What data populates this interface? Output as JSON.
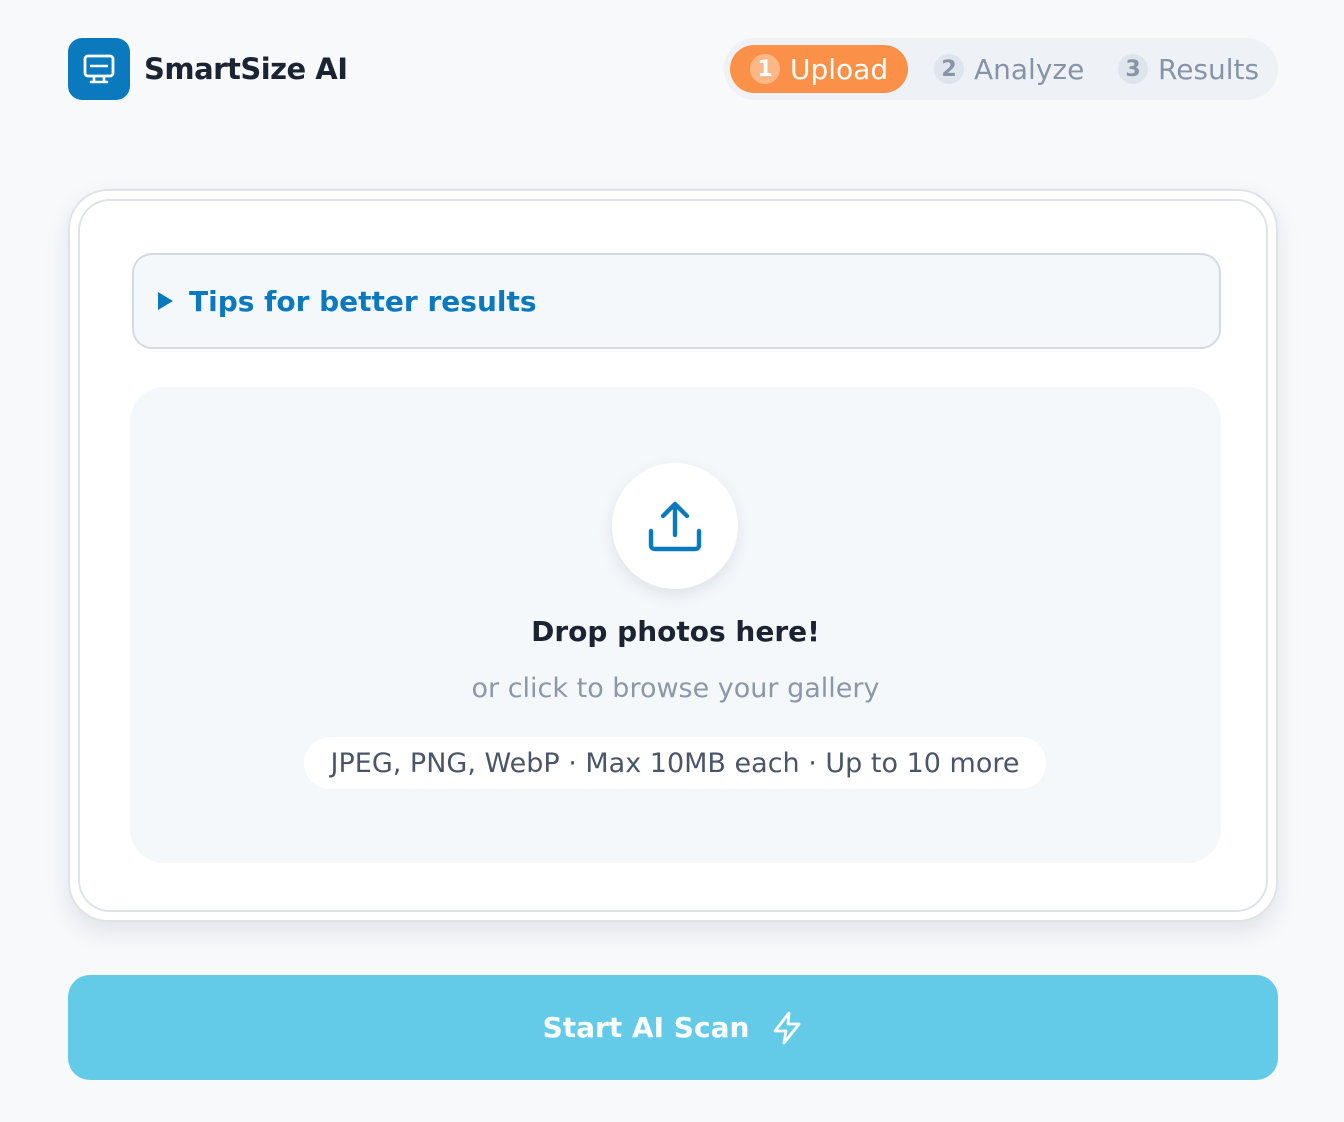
{
  "brand": {
    "name": "SmartSize AI",
    "icon": "monitor-icon",
    "color": "#0a79be"
  },
  "steps": [
    {
      "number": "1",
      "label": "Upload",
      "active": true
    },
    {
      "number": "2",
      "label": "Analyze",
      "active": false
    },
    {
      "number": "3",
      "label": "Results",
      "active": false
    }
  ],
  "tips": {
    "label": "Tips for better results",
    "icon": "caret-right-icon"
  },
  "dropzone": {
    "icon": "upload-icon",
    "title": "Drop photos here!",
    "subtitle": "or click to browse your gallery",
    "formats": "JPEG, PNG, WebP · Max 10MB each · Up to 10 more"
  },
  "cta": {
    "label": "Start AI Scan",
    "icon": "lightning-icon",
    "color": "#63cbe8"
  },
  "colors": {
    "accent": "#0a79be",
    "active_step": "#fb9148",
    "background": "#f7f9fb"
  }
}
